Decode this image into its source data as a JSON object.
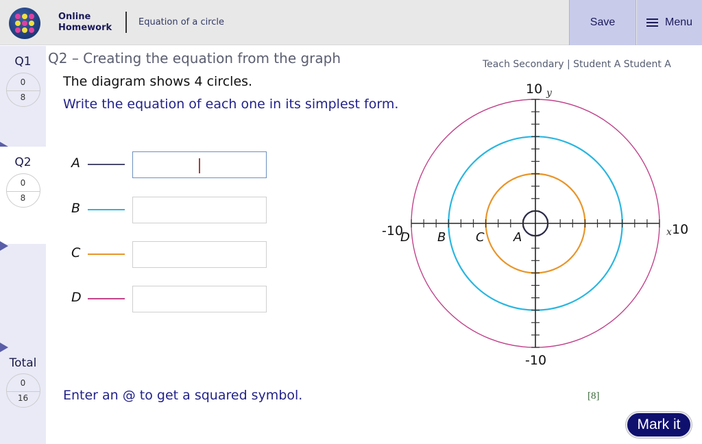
{
  "header": {
    "brand_line1": "Online",
    "brand_line2": "Homework",
    "subject": "Equation of a circle",
    "save_label": "Save",
    "menu_label": "Menu",
    "logo_icon": "dots-grid-logo",
    "menu_icon": "hamburger-icon"
  },
  "sidebar": {
    "questions": [
      {
        "label": "Q1",
        "score": "0",
        "max": "8",
        "active": false
      },
      {
        "label": "Q2",
        "score": "0",
        "max": "8",
        "active": true
      }
    ],
    "total": {
      "label": "Total",
      "score": "0",
      "max": "16"
    }
  },
  "question": {
    "title": "Q2 – Creating the equation from the graph",
    "attribution": "Teach Secondary | Student A Student A",
    "stem_line1": "The diagram shows 4 circles.",
    "stem_line2": "Write the equation of each one in its simplest form.",
    "answers": [
      {
        "letter": "A",
        "color": "#4a4a6e",
        "value": "",
        "focused": true
      },
      {
        "letter": "B",
        "color": "#29b6e0",
        "value": "",
        "focused": false
      },
      {
        "letter": "C",
        "color": "#e8952a",
        "value": "",
        "focused": false
      },
      {
        "letter": "D",
        "color": "#c0428a",
        "value": "",
        "focused": false
      }
    ],
    "hint": "Enter an @ to get a squared symbol.",
    "marks": "[8]",
    "mark_button": "Mark it"
  },
  "graph": {
    "x_min_label": "-10",
    "x_max_label": "10",
    "y_min_label": "-10",
    "y_max_label": "10",
    "x_var": "x",
    "y_var": "y",
    "axis_range": [
      -10,
      10
    ],
    "tick_step": 1,
    "circles": [
      {
        "label": "A",
        "radius": 1,
        "color": "#2a2a48"
      },
      {
        "label": "C",
        "radius": 4,
        "color": "#e8952a"
      },
      {
        "label": "B",
        "radius": 7,
        "color": "#29b6e0"
      },
      {
        "label": "D",
        "radius": 10,
        "color": "#c0428a"
      }
    ]
  }
}
